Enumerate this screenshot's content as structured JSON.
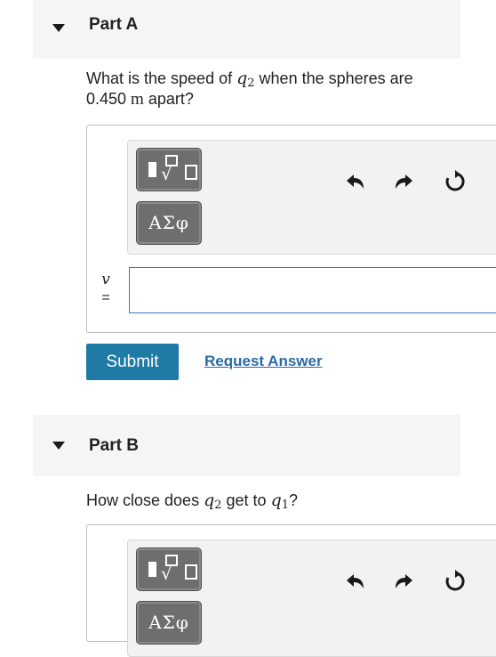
{
  "part_a": {
    "title": "Part A",
    "question_pre": "What is the speed of ",
    "var_q": "q",
    "var_q_sub": "2",
    "question_mid": " when the spheres are",
    "question_value": "0.450 ",
    "question_unit": "m",
    "question_post": " apart?",
    "answer_var": "v",
    "answer_eq": "=",
    "answer_value": "",
    "templates_label": "templates",
    "symbols_label": "ΑΣφ",
    "submit_label": "Submit",
    "request_label": "Request Answer"
  },
  "part_b": {
    "title": "Part B",
    "question_pre": "How close does ",
    "var_q": "q",
    "var_q_sub": "2",
    "question_mid": " get to ",
    "var_q1": "q",
    "var_q1_sub": "1",
    "question_post": "?",
    "symbols_label": "ΑΣφ"
  },
  "colors": {
    "submit_bg": "#1f7aa5",
    "link": "#2c6aa6",
    "header_bg": "#f5f5f5",
    "tool_button_bg": "#6e6e6e",
    "input_border": "#3a78b5"
  },
  "icons": {
    "undo": "undo-icon",
    "redo": "redo-icon",
    "reset": "reset-icon",
    "keyboard": "keyboard-icon"
  }
}
